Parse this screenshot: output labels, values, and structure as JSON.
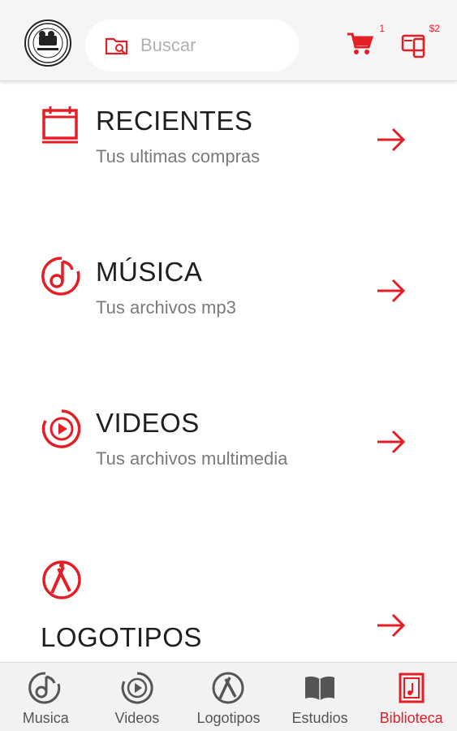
{
  "colors": {
    "accent": "#e41e26",
    "text": "#1f1f1f",
    "muted": "#7a7a7a",
    "header_bg": "#f5f5f5"
  },
  "header": {
    "logo_icon": "seal-logo-icon",
    "search": {
      "placeholder": "Buscar",
      "icon": "folder-search-icon"
    },
    "cart": {
      "icon": "cart-icon",
      "badge": "1"
    },
    "wallet": {
      "icon": "wallet-icon",
      "badge": "$2"
    }
  },
  "items": [
    {
      "title": "RECIENTES",
      "subtitle": "Tus ultimas compras",
      "icon": "calendar-icon"
    },
    {
      "title": "MÚSICA",
      "subtitle": "Tus archivos mp3",
      "icon": "music-note-icon"
    },
    {
      "title": "VIDEOS",
      "subtitle": "Tus archivos multimedia",
      "icon": "play-circle-icon"
    },
    {
      "title": "LOGOTIPOS",
      "subtitle": "",
      "icon": "brushes-icon"
    }
  ],
  "bottom_nav": [
    {
      "label": "Musica",
      "icon": "music-note-icon",
      "active": false
    },
    {
      "label": "Videos",
      "icon": "play-circle-icon",
      "active": false
    },
    {
      "label": "Logotipos",
      "icon": "brushes-icon",
      "active": false
    },
    {
      "label": "Estudios",
      "icon": "book-icon",
      "active": false
    },
    {
      "label": "Biblioteca",
      "icon": "library-icon",
      "active": true
    }
  ]
}
